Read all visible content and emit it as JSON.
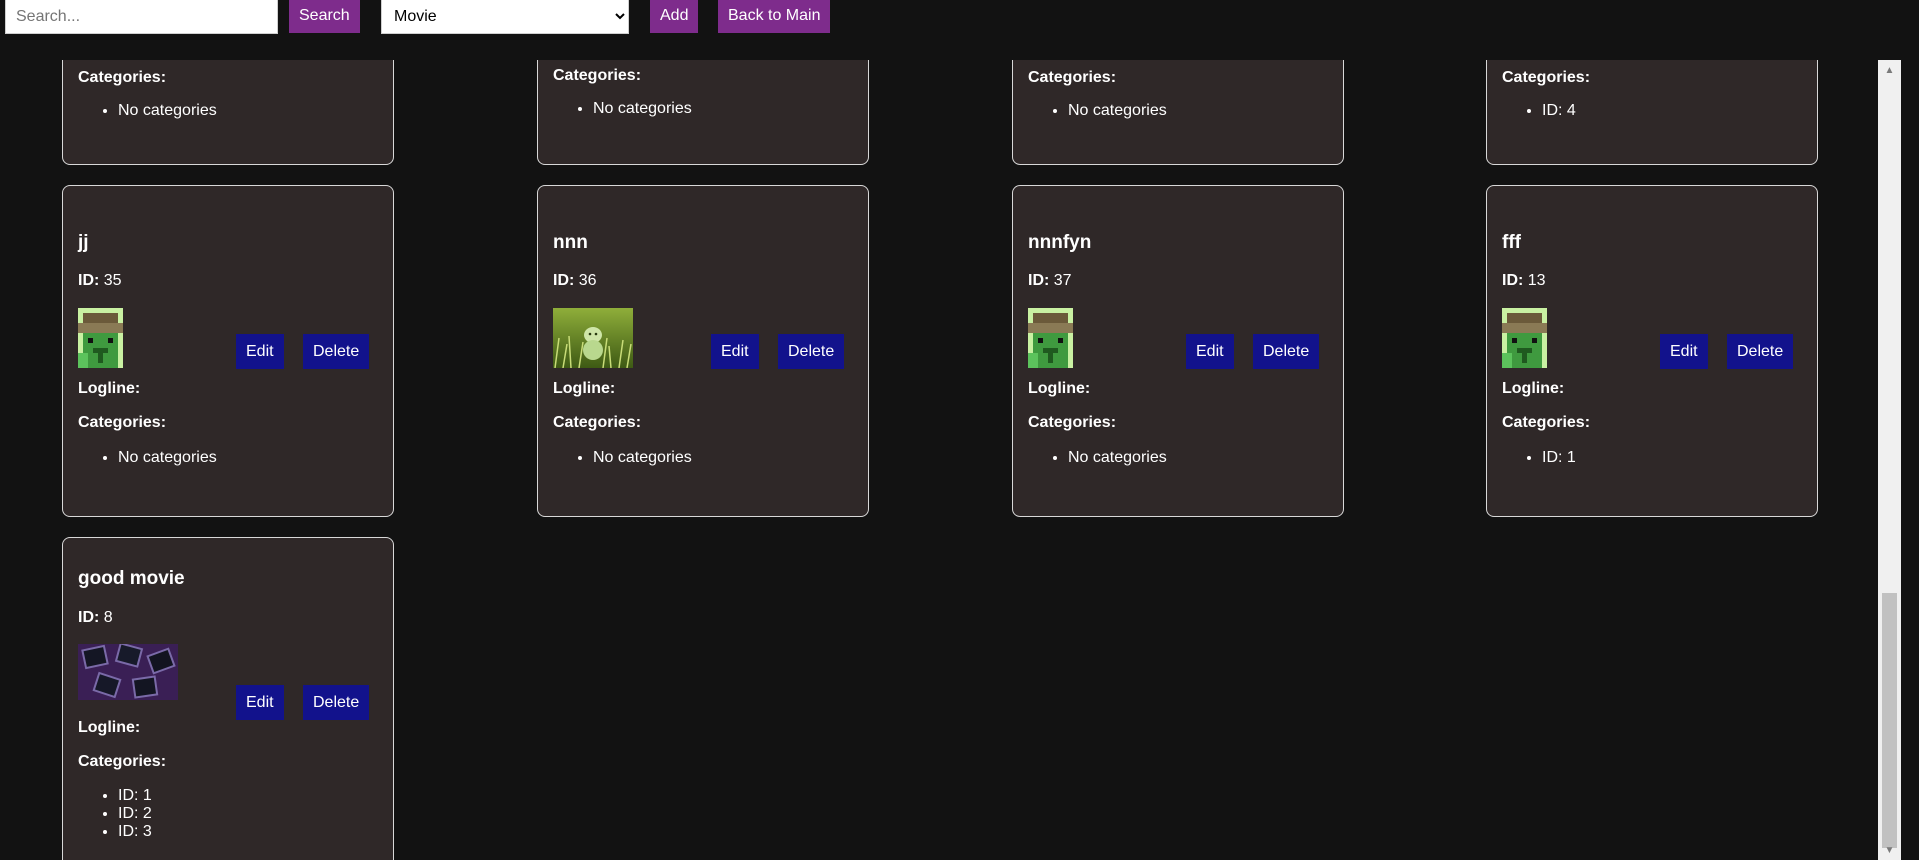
{
  "toolbar": {
    "search_placeholder": "Search...",
    "search_button": "Search",
    "type_selected": "Movie",
    "type_options": [
      "Movie"
    ],
    "add_button": "Add",
    "back_button": "Back to Main"
  },
  "labels": {
    "id": "ID:",
    "logline": "Logline:",
    "categories": "Categories:",
    "edit": "Edit",
    "delete": "Delete"
  },
  "top_row": [
    {
      "categories": [
        "No categories"
      ]
    },
    {
      "categories": [
        "No categories"
      ]
    },
    {
      "categories": [
        "No categories"
      ]
    },
    {
      "categories": [
        "ID: 4"
      ]
    }
  ],
  "cards": [
    {
      "title": "jj",
      "id": "35",
      "image": "pixel-zombie-icon",
      "logline": "",
      "categories": [
        "No categories"
      ]
    },
    {
      "title": "nnn",
      "id": "36",
      "image": "grass-figurine-photo",
      "logline": "",
      "categories": [
        "No categories"
      ]
    },
    {
      "title": "nnnfyn",
      "id": "37",
      "image": "pixel-zombie-icon",
      "logline": "",
      "categories": [
        "No categories"
      ]
    },
    {
      "title": "fff",
      "id": "13",
      "image": "pixel-zombie-icon",
      "logline": "",
      "categories": [
        "ID: 1"
      ]
    },
    {
      "title": "good movie",
      "id": "8",
      "image": "polaroid-pattern-image",
      "logline": "",
      "categories": [
        "ID: 1",
        "ID: 2",
        "ID: 3"
      ]
    }
  ],
  "colors": {
    "background": "#121212",
    "card": "#2f2828",
    "purple_button": "#7e2c8c",
    "blue_button": "#12128c"
  }
}
